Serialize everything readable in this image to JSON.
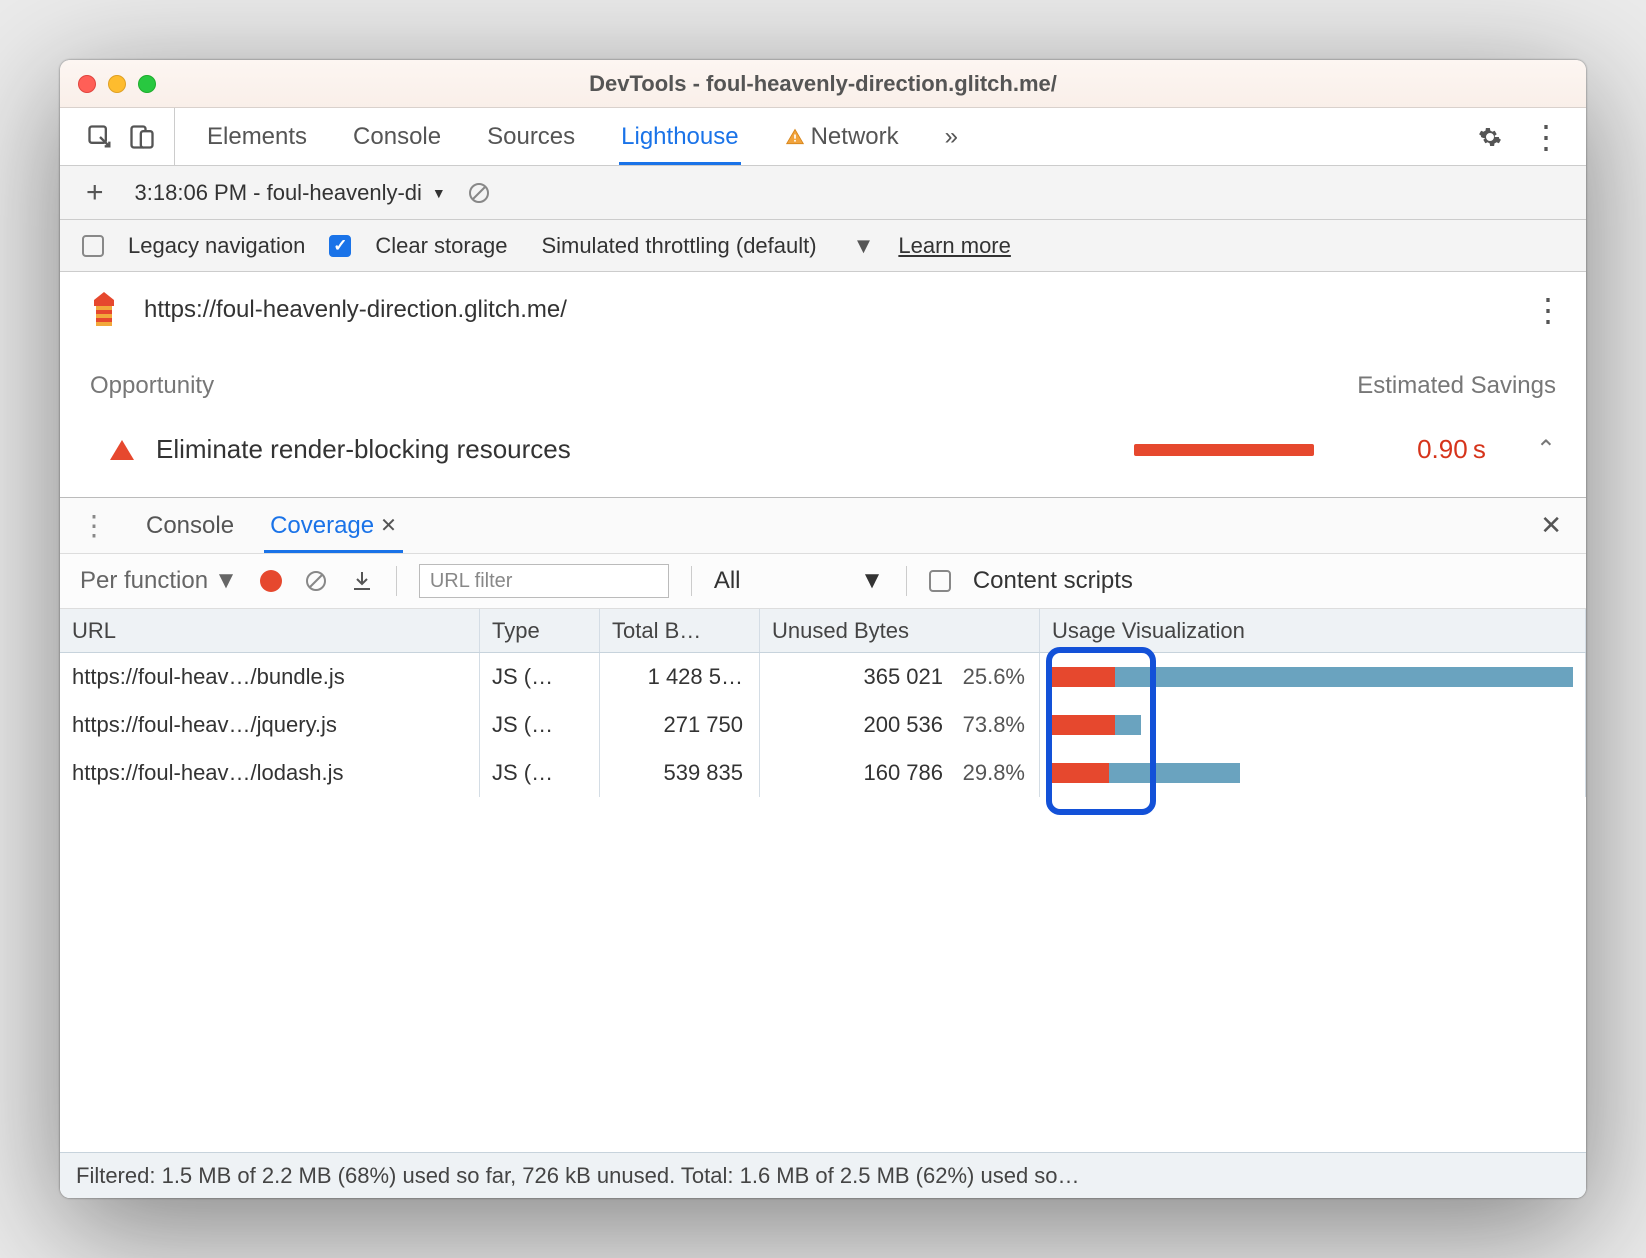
{
  "window": {
    "title": "DevTools - foul-heavenly-direction.glitch.me/"
  },
  "tabs": {
    "elements": "Elements",
    "console": "Console",
    "sources": "Sources",
    "lighthouse": "Lighthouse",
    "network": "Network",
    "more": "»"
  },
  "lighthouse": {
    "run_label": "3:18:06 PM - foul-heavenly-di",
    "legacy_label": "Legacy navigation",
    "clear_label": "Clear storage",
    "throttle_label": "Simulated throttling (default)",
    "learn_more": "Learn more",
    "url": "https://foul-heavenly-direction.glitch.me/",
    "opportunity_header": "Opportunity",
    "savings_header": "Estimated Savings",
    "opportunity_title": "Eliminate render-blocking resources",
    "opportunity_time": "0.90 s"
  },
  "drawer": {
    "console": "Console",
    "coverage": "Coverage"
  },
  "coverage": {
    "mode": "Per function",
    "url_filter_placeholder": "URL filter",
    "type_filter": "All",
    "content_scripts": "Content scripts",
    "columns": {
      "url": "URL",
      "type": "Type",
      "total": "Total B…",
      "unused": "Unused Bytes",
      "vis": "Usage Visualization"
    },
    "rows": [
      {
        "url": "https://foul-heav…/bundle.js",
        "type": "JS (…",
        "total": "1 428 5…",
        "unused": "365 021",
        "pct": "25.6%",
        "red": 12,
        "blue": 88
      },
      {
        "url": "https://foul-heav…/jquery.js",
        "type": "JS (…",
        "total": "271 750",
        "unused": "200 536",
        "pct": "73.8%",
        "red": 12,
        "blue": 5
      },
      {
        "url": "https://foul-heav…/lodash.js",
        "type": "JS (…",
        "total": "539 835",
        "unused": "160 786",
        "pct": "29.8%",
        "red": 11,
        "blue": 25
      }
    ],
    "status": "Filtered: 1.5 MB of 2.2 MB (68%) used so far, 726 kB unused. Total: 1.6 MB of 2.5 MB (62%) used so…"
  }
}
